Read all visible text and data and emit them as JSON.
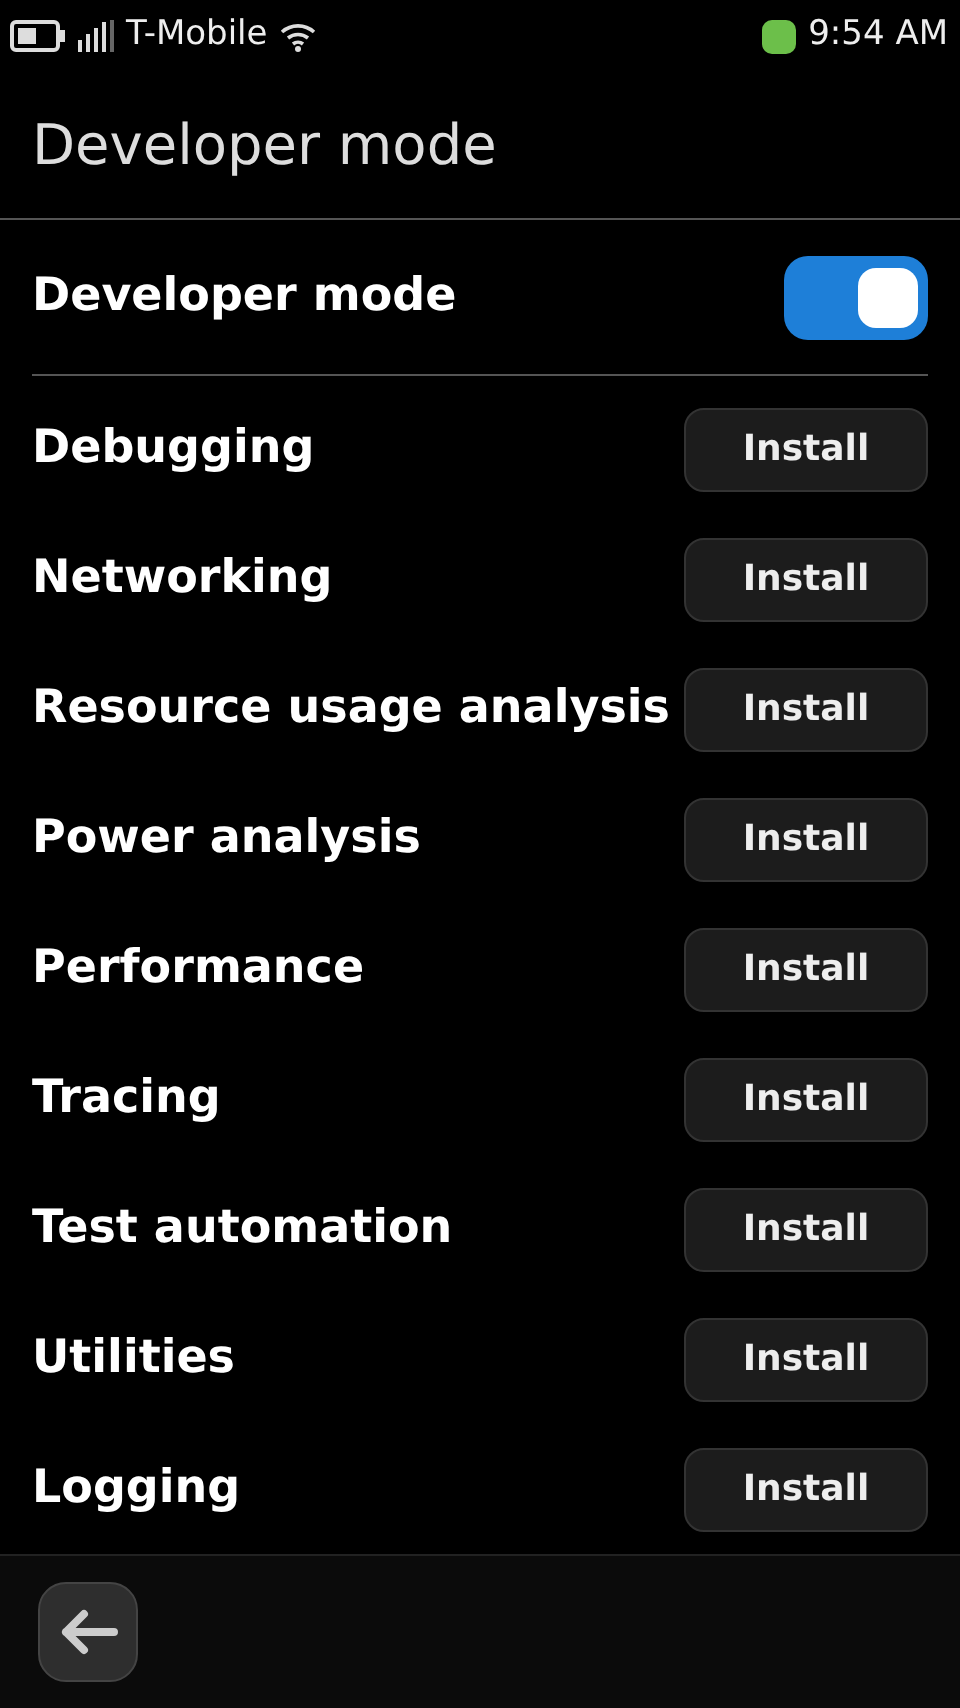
{
  "status_bar": {
    "carrier": "T-Mobile",
    "time": "9:54 AM"
  },
  "title": "Developer mode",
  "developer_mode": {
    "label": "Developer mode",
    "on": true
  },
  "packages": [
    {
      "label": "Debugging",
      "button": "Install"
    },
    {
      "label": "Networking",
      "button": "Install"
    },
    {
      "label": "Resource usage analysis",
      "button": "Install"
    },
    {
      "label": "Power analysis",
      "button": "Install"
    },
    {
      "label": "Performance",
      "button": "Install"
    },
    {
      "label": "Tracing",
      "button": "Install"
    },
    {
      "label": "Test automation",
      "button": "Install"
    },
    {
      "label": "Utilities",
      "button": "Install"
    },
    {
      "label": "Logging",
      "button": "Install"
    }
  ]
}
